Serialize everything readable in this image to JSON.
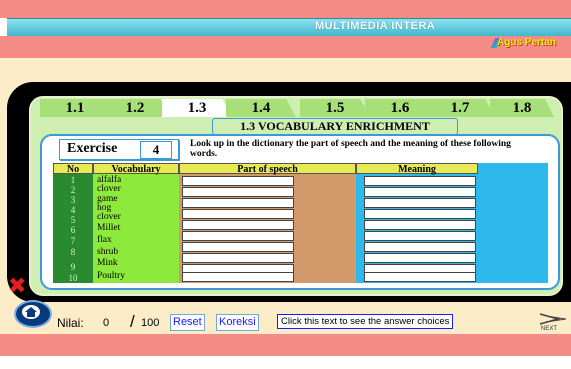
{
  "header": {
    "title": "MULTIMEDIA INTERA",
    "author": "Agus Pertan"
  },
  "tabs": [
    {
      "label": "1.1",
      "active": false
    },
    {
      "label": "1.2",
      "active": false
    },
    {
      "label": "1.3",
      "active": true
    },
    {
      "label": "1.4",
      "active": false
    },
    {
      "label": "1.5",
      "active": false
    },
    {
      "label": "1.6",
      "active": false
    },
    {
      "label": "1.7",
      "active": false
    },
    {
      "label": "1.8",
      "active": false
    }
  ],
  "section_title": "1.3 VOCABULARY ENRICHMENT",
  "exercise": {
    "label": "Exercise",
    "number": "4"
  },
  "instruction": "Look up in the dictionary the part of speech and the meaning of these following words.",
  "table": {
    "headers": {
      "no": "No",
      "vocab": "Vocabulary",
      "pos": "Part of speech",
      "meaning": "Meaning"
    },
    "rows": [
      {
        "no": "1",
        "word": "alfalfa"
      },
      {
        "no": "2",
        "word": "clover"
      },
      {
        "no": "3",
        "word": "game"
      },
      {
        "no": "4",
        "word": "hog"
      },
      {
        "no": "5",
        "word": "clover"
      },
      {
        "no": "6",
        "word": "Millet"
      },
      {
        "no": "7",
        "word": "flax"
      },
      {
        "no": "8",
        "word": "shrub"
      },
      {
        "no": "9",
        "word": "Mink"
      },
      {
        "no": "10",
        "word": "Poultry"
      }
    ]
  },
  "footer": {
    "nilai_label": "Nilai:",
    "score": "0",
    "slash": "/",
    "total": "100",
    "reset_label": "Reset",
    "koreksi_label": "Koreksi",
    "answer_label": "Click this text to see the answer choices",
    "next_label": "NEXT"
  },
  "colors": {
    "accent": "#3a9ad9",
    "bar": "#f38b87",
    "cream": "#fdecc8",
    "panel": "#cfeeb2"
  }
}
